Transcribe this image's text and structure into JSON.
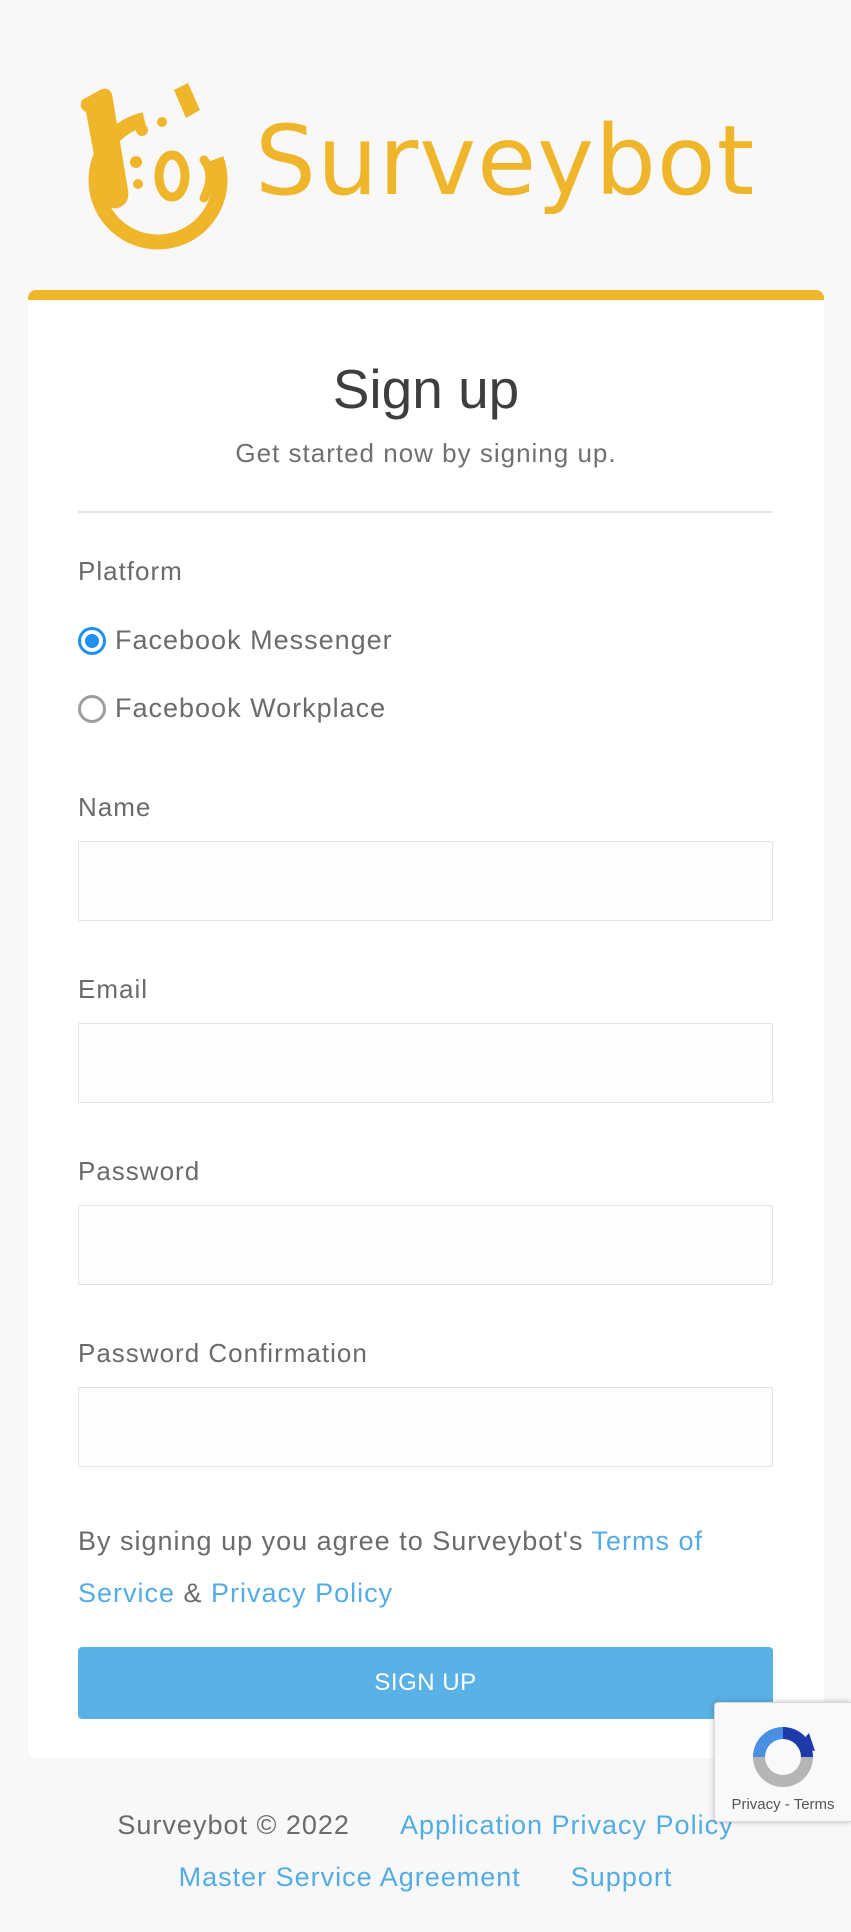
{
  "brand": {
    "name": "Surveybot",
    "color": "#f0b62b",
    "logo_icon": "surveybot-mascot-icon"
  },
  "form": {
    "title": "Sign up",
    "subtitle": "Get started now by signing up.",
    "platform_label": "Platform",
    "platform_options": [
      {
        "label": "Facebook Messenger",
        "checked": true
      },
      {
        "label": "Facebook Workplace",
        "checked": false
      }
    ],
    "fields": {
      "name": {
        "label": "Name",
        "value": "",
        "placeholder": ""
      },
      "email": {
        "label": "Email",
        "value": "",
        "placeholder": ""
      },
      "password": {
        "label": "Password",
        "value": "",
        "placeholder": ""
      },
      "password_confirmation": {
        "label": "Password Confirmation",
        "value": "",
        "placeholder": ""
      }
    },
    "agreement": {
      "prefix": "By signing up you agree to Surveybot's ",
      "terms_link": "Terms of Service",
      "ampersand": " & ",
      "privacy_link": "Privacy Policy"
    },
    "submit_label": "SIGN UP",
    "accent_color": "#5ab1e5"
  },
  "footer": {
    "copyright": "Surveybot © 2022",
    "links": {
      "app_privacy": "Application Privacy Policy",
      "msa": "Master Service Agreement",
      "support": "Support"
    }
  },
  "recaptcha": {
    "privacy": "Privacy",
    "separator": " - ",
    "terms": "Terms",
    "icon": "recaptcha-icon"
  }
}
